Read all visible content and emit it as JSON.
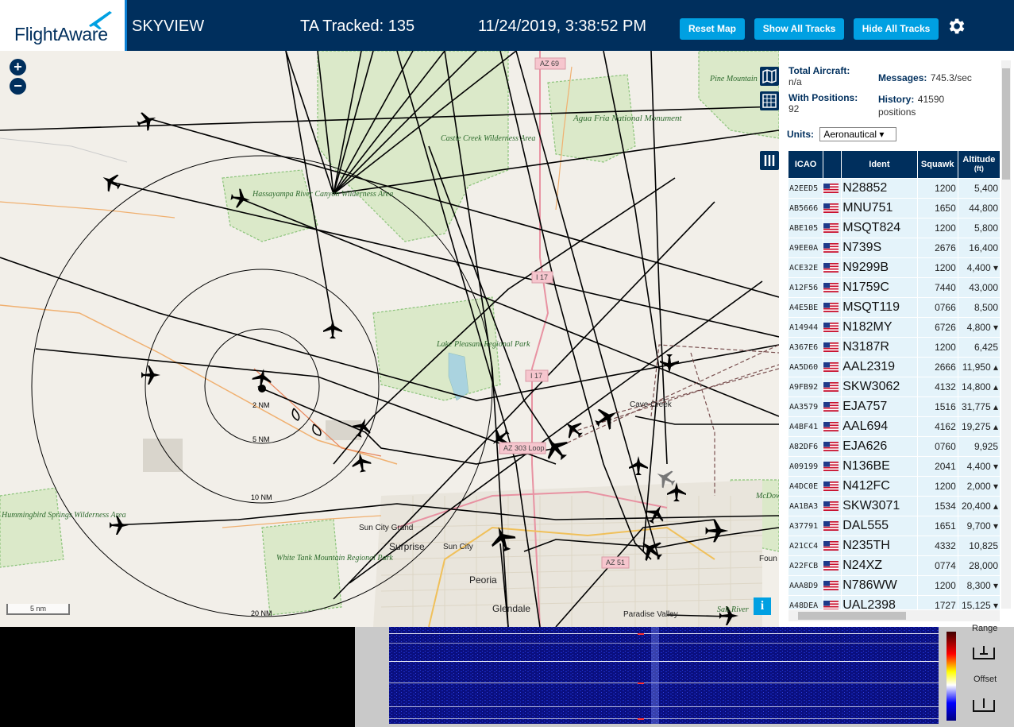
{
  "header": {
    "logo_text": "FlightAware",
    "app_title": "SKYVIEW",
    "tracked_label": "TA Tracked: 135",
    "datetime": "11/24/2019, 3:38:52 PM",
    "buttons": {
      "reset_map": "Reset Map",
      "show_all_tracks": "Show All Tracks",
      "hide_all_tracks": "Hide All Tracks"
    },
    "settings_icon": "gear-icon"
  },
  "map": {
    "zoom_in": "+",
    "zoom_out": "−",
    "scale_label": "5 nm",
    "info_label": "i",
    "range_rings": [
      "2 NM",
      "5 NM",
      "10 NM",
      "20 NM"
    ],
    "labels": {
      "az69": "AZ 69",
      "pine_mountain": "Pine Mountain Wilderness Area",
      "agua_fria": "Agua Fria National Monument",
      "castle_creek": "Castle Creek Wilderness Area",
      "hassayampa": "Hassayampa River Canyon Wilderness Area",
      "i17_a": "I 17",
      "i17_b": "I 17",
      "lake_pleasant": "Lake Pleasant Regional Park",
      "cave_creek": "Cave Creek",
      "az303": "AZ 303 Loop",
      "mcdowell": "McDowell Mountain Regional Park",
      "hummingbird": "Hummingbird Springs Wilderness Area",
      "sun_city_grand": "Sun City Grand",
      "surprise": "Surprise",
      "sun_city": "Sun City",
      "white_tank": "White Tank Mountain Regional Park",
      "peoria": "Peoria",
      "glendale": "Glendale",
      "az51": "AZ 51",
      "paradise_valley": "Paradise Valley",
      "salt_river": "Salt River",
      "fountain": "Foun"
    }
  },
  "sidebar": {
    "total_aircraft_label": "Total Aircraft:",
    "total_aircraft_value": "n/a",
    "with_positions_label": "With Positions:",
    "with_positions_value": "92",
    "messages_label": "Messages:",
    "messages_value": "745.3/sec",
    "history_label": "History:",
    "history_value": "41590",
    "history_unit": "positions",
    "units_label": "Units:",
    "units_value": "Aeronautical ▾",
    "columns": {
      "icao": "ICAO",
      "ident": "Ident",
      "squawk": "Squawk",
      "altitude": "Altitude",
      "altitude_unit": "(ft)"
    },
    "rows": [
      {
        "icao": "A2EED5",
        "ident": "N28852",
        "squawk": "1200",
        "alt": "5,400"
      },
      {
        "icao": "AB5666",
        "ident": "MNU751",
        "squawk": "1650",
        "alt": "44,800"
      },
      {
        "icao": "ABE105",
        "ident": "MSQT824",
        "squawk": "1200",
        "alt": "5,800"
      },
      {
        "icao": "A9EE0A",
        "ident": "N739S",
        "squawk": "2676",
        "alt": "16,400"
      },
      {
        "icao": "ACE32E",
        "ident": "N9299B",
        "squawk": "1200",
        "alt": "4,400 ▾"
      },
      {
        "icao": "A12F56",
        "ident": "N1759C",
        "squawk": "7440",
        "alt": "43,000"
      },
      {
        "icao": "A4E5BE",
        "ident": "MSQT119",
        "squawk": "0766",
        "alt": "8,500"
      },
      {
        "icao": "A14944",
        "ident": "N182MY",
        "squawk": "6726",
        "alt": "4,800 ▾"
      },
      {
        "icao": "A367E6",
        "ident": "N3187R",
        "squawk": "1200",
        "alt": "6,425"
      },
      {
        "icao": "AA5D60",
        "ident": "AAL2319",
        "squawk": "2666",
        "alt": "11,950 ▴"
      },
      {
        "icao": "A9FB92",
        "ident": "SKW3062",
        "squawk": "4132",
        "alt": "14,800 ▴"
      },
      {
        "icao": "AA3579",
        "ident": "EJA757",
        "squawk": "1516",
        "alt": "31,775 ▴"
      },
      {
        "icao": "A4BF41",
        "ident": "AAL694",
        "squawk": "4162",
        "alt": "19,275 ▴"
      },
      {
        "icao": "A82DF6",
        "ident": "EJA626",
        "squawk": "0760",
        "alt": "9,925"
      },
      {
        "icao": "A09199",
        "ident": "N136BE",
        "squawk": "2041",
        "alt": "4,400 ▾"
      },
      {
        "icao": "A4DC0E",
        "ident": "N412FC",
        "squawk": "1200",
        "alt": "2,000 ▾"
      },
      {
        "icao": "AA1BA3",
        "ident": "SKW3071",
        "squawk": "1534",
        "alt": "20,400 ▴"
      },
      {
        "icao": "A37791",
        "ident": "DAL555",
        "squawk": "1651",
        "alt": "9,700 ▾"
      },
      {
        "icao": "A21CC4",
        "ident": "N235TH",
        "squawk": "4332",
        "alt": "10,825"
      },
      {
        "icao": "A22FCB",
        "ident": "N24XZ",
        "squawk": "0774",
        "alt": "28,000"
      },
      {
        "icao": "AAA8D9",
        "ident": "N786WW",
        "squawk": "1200",
        "alt": "8,300 ▾"
      },
      {
        "icao": "A48DEA",
        "ident": "UAL2398",
        "squawk": "1727",
        "alt": "15,125 ▾"
      }
    ]
  },
  "spectrum": {
    "range_label": "Range",
    "offset_label": "Offset"
  },
  "colors": {
    "header_bg": "#002F5D",
    "button_bg": "#00A0E2",
    "row_bg": "#e4f3fa"
  }
}
